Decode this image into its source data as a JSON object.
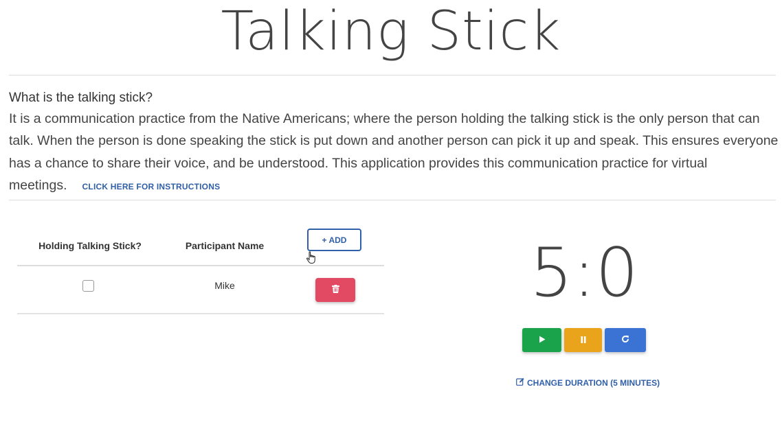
{
  "header": {
    "title": "Talking Stick"
  },
  "about": {
    "question": "What is the talking stick?",
    "text": "It is a communication practice from the Native Americans; where the person holding the talking stick is the only person that can talk. When the person is done speaking the stick is put down and another person can pick it up and speak. This ensures everyone has a chance to share their voice, and be understood. This application provides this communication practice for virtual meetings.",
    "instructions_link": "CLICK HERE FOR INSTRUCTIONS"
  },
  "table": {
    "col_holding": "Holding Talking Stick?",
    "col_name": "Participant Name",
    "add_label": "+ ADD",
    "rows": [
      {
        "holding": false,
        "name": "Mike"
      }
    ]
  },
  "timer": {
    "display": "5:0",
    "change_duration_label": "CHANGE DURATION (5 MINUTES)"
  },
  "colors": {
    "play": "#1aa34a",
    "pause": "#e9a41c",
    "reset": "#3b73d4",
    "delete": "#e24a64",
    "link": "#2f5fa8"
  },
  "icons": [
    "play-icon",
    "pause-icon",
    "reset-icon",
    "trash-icon",
    "edit-icon",
    "hand-cursor-icon"
  ]
}
